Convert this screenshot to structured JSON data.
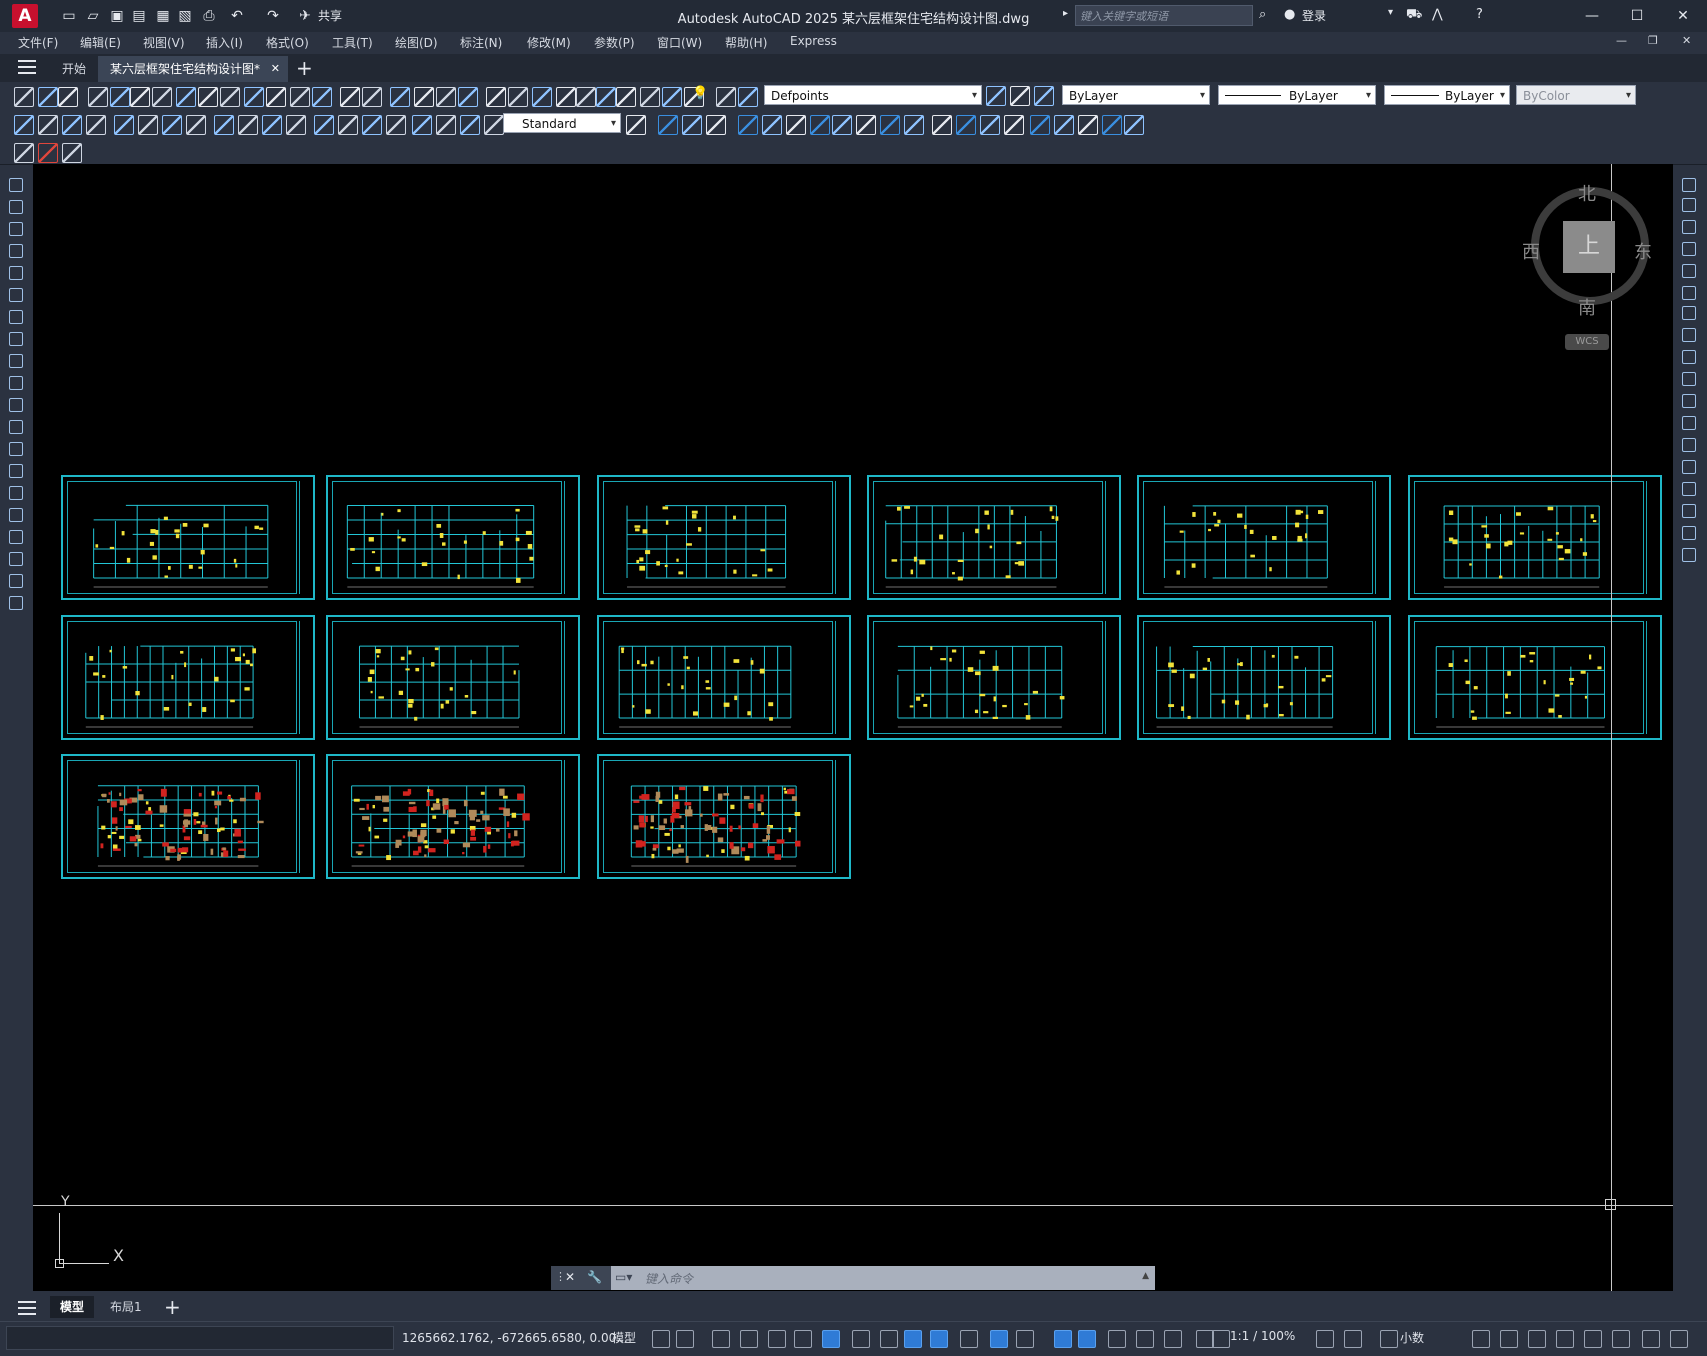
{
  "app": {
    "logo_letter": "A",
    "window_title": "Autodesk AutoCAD 2025    某六层框架住宅结构设计图.dwg",
    "share_label": "共享",
    "search_placeholder": "键入关键字或短语",
    "login_label": "登录"
  },
  "menu": [
    "文件(F)",
    "编辑(E)",
    "视图(V)",
    "插入(I)",
    "格式(O)",
    "工具(T)",
    "绘图(D)",
    "标注(N)",
    "修改(M)",
    "参数(P)",
    "窗口(W)",
    "帮助(H)",
    "Express"
  ],
  "doc_tabs": [
    {
      "label": "开始",
      "active": false
    },
    {
      "label": "某六层框架住宅结构设计图*",
      "active": true
    }
  ],
  "toolbar": {
    "layer_value": "Defpoints",
    "color_value": "ByLayer",
    "linetype_value": "ByLayer",
    "lineweight_value": "ByLayer",
    "plotstyle_value": "ByColor",
    "dimstyle_value": "Standard"
  },
  "viewcube": {
    "north": "北",
    "south": "南",
    "east": "东",
    "west": "西",
    "top_face": "上",
    "wcs_label": "WCS"
  },
  "ucs": {
    "x_label": "X",
    "y_label": "Y"
  },
  "command_line": {
    "placeholder": "键入命令"
  },
  "layout_tabs": [
    {
      "label": "模型",
      "active": true
    },
    {
      "label": "布局1",
      "active": false
    }
  ],
  "status": {
    "coordinates": "1265662.1762, -672665.6580, 0.00...",
    "model_label": "模型",
    "annotation_scale": "1:1 / 100%",
    "units": "小数"
  },
  "colors": {
    "canvas": "#000000",
    "sheet_frame": "#1fb8c8",
    "ui_dark": "#2b3240",
    "cmdline": "#a9b0bd"
  }
}
